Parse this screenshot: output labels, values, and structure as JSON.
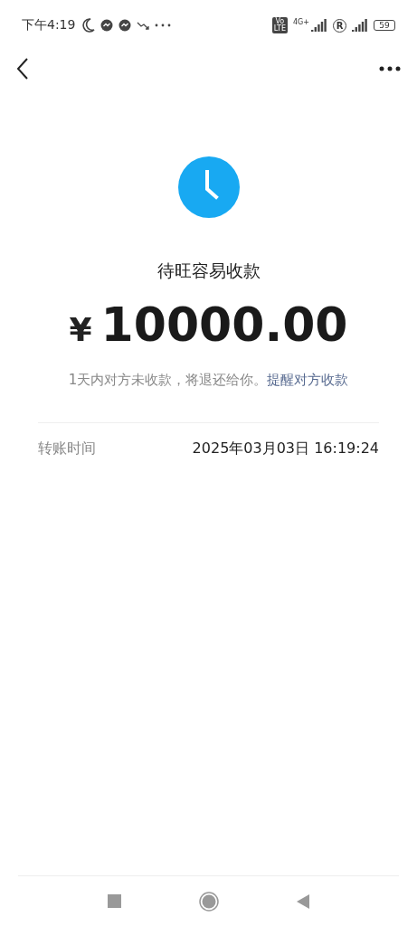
{
  "status_bar": {
    "time": "下午4:19",
    "volte": [
      "Vo",
      "LTE"
    ],
    "network": "4G+",
    "roaming": "R",
    "battery": "59"
  },
  "detail": {
    "title": "待旺容易收款",
    "currency": "¥",
    "amount": "10000.00",
    "note": "1天内对方未收款，将退还给你。",
    "remind_link": "提醒对方收款"
  },
  "rows": [
    {
      "label": "转账时间",
      "value": "2025年03月03日 16:19:24"
    }
  ]
}
